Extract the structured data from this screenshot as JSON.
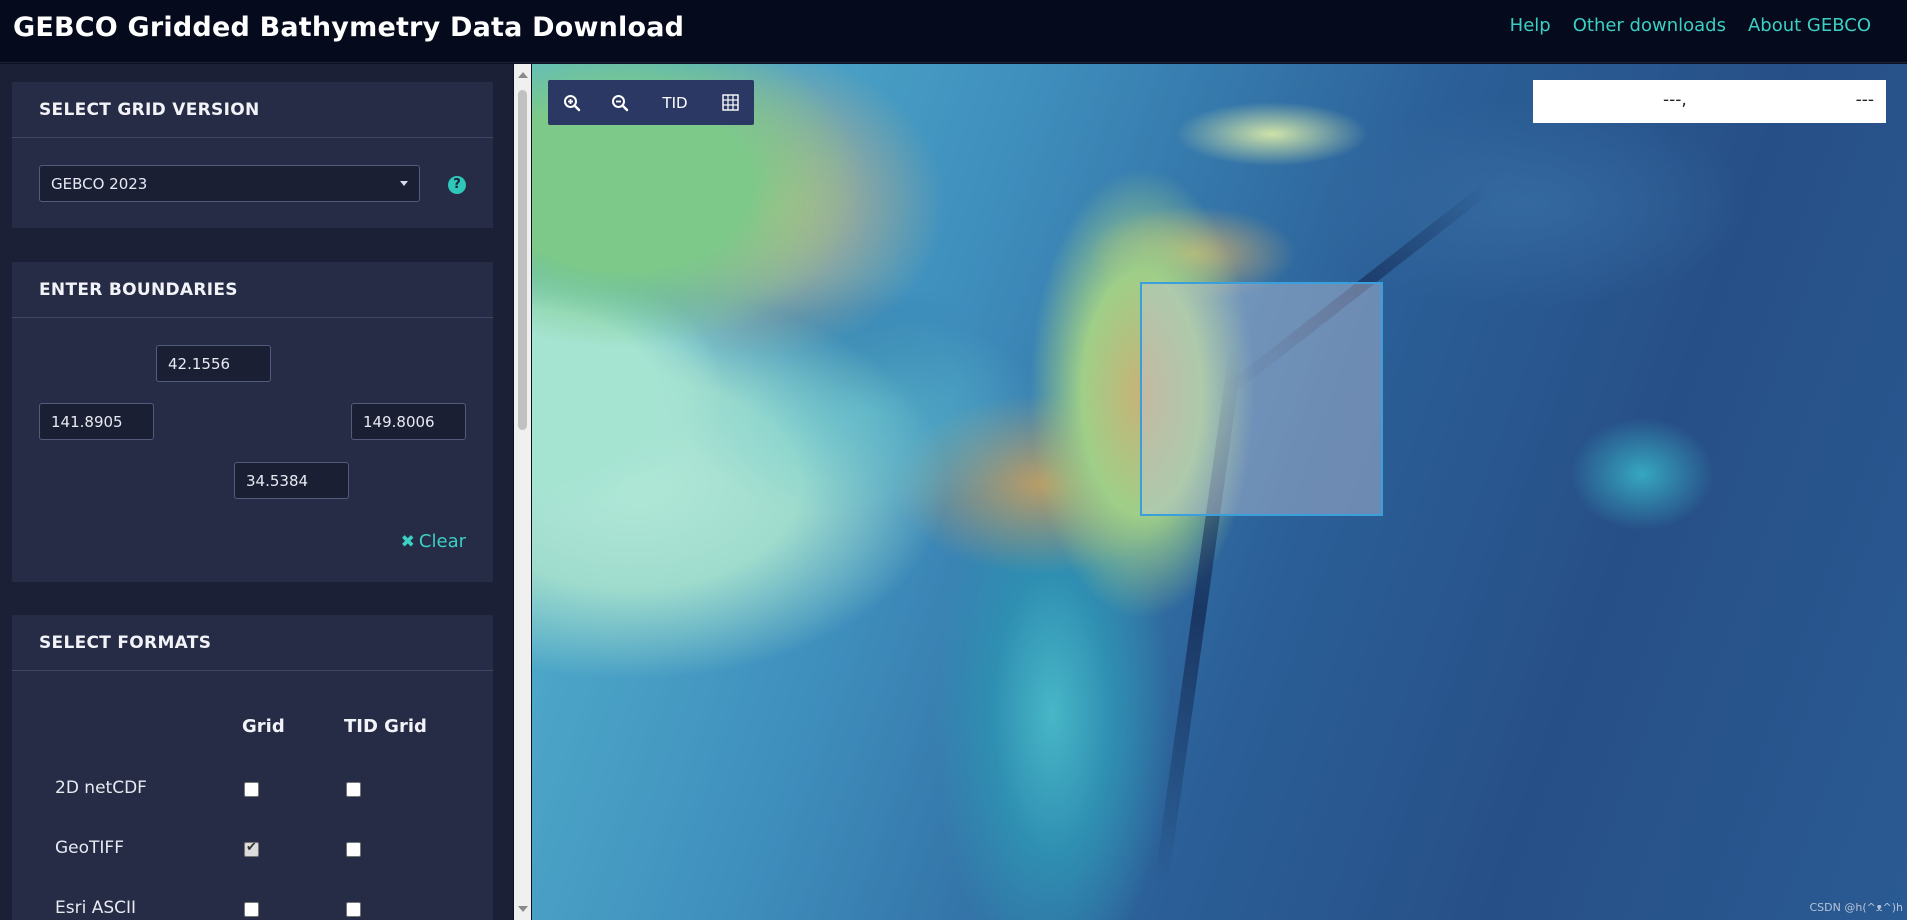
{
  "header": {
    "title": "GEBCO Gridded Bathymetry Data Download",
    "nav": [
      "Help",
      "Other downloads",
      "About GEBCO"
    ]
  },
  "grid_version": {
    "heading": "SELECT GRID VERSION",
    "selected": "GEBCO 2023",
    "help_glyph": "?"
  },
  "boundaries": {
    "heading": "ENTER BOUNDARIES",
    "north": "42.1556",
    "west": "141.8905",
    "east": "149.8006",
    "south": "34.5384",
    "clear_label": "Clear",
    "clear_icon": "✖"
  },
  "formats": {
    "heading": "SELECT FORMATS",
    "columns": [
      "Grid",
      "TID Grid"
    ],
    "rows": [
      {
        "label": "2D netCDF",
        "grid": false,
        "tid": false
      },
      {
        "label": "GeoTIFF",
        "grid": true,
        "tid": false
      },
      {
        "label": "Esri ASCII",
        "grid": false,
        "tid": false
      }
    ]
  },
  "map": {
    "tools": {
      "zoom_in": "zoom-in-icon",
      "zoom_out": "zoom-out-icon",
      "tid_label": "TID",
      "grid": "grid-icon"
    },
    "readout": {
      "left": "---,",
      "right": "---"
    },
    "watermark": "CSDN @h(^ᴥ^)h"
  },
  "colors": {
    "accent": "#3ccfc3",
    "header_bg": "#050a1c",
    "panel_bg": "#262c45",
    "selection_border": "#3b9fdb"
  }
}
